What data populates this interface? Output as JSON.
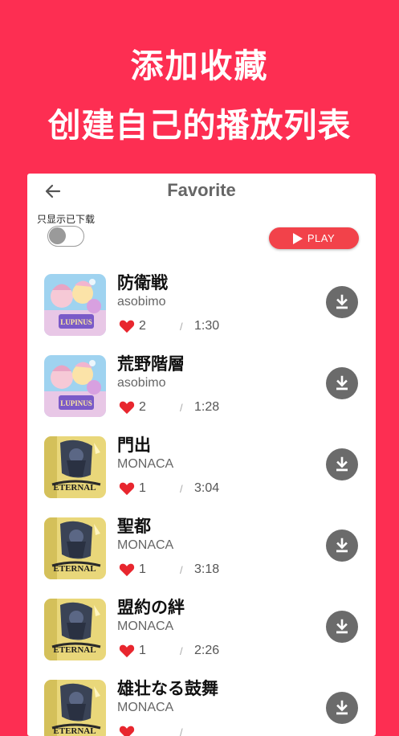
{
  "promo": {
    "line1": "添加收藏",
    "line2": "创建自己的播放列表"
  },
  "header": {
    "title": "Favorite",
    "back_icon": "arrow-left-icon"
  },
  "filter": {
    "label": "只显示已下载",
    "toggle_on": false
  },
  "play_button": {
    "label": "PLAY",
    "icon": "play-icon"
  },
  "colors": {
    "background": "#fd2e52",
    "play_button": "#f2424a",
    "heart": "#e8262e",
    "download_button": "#6b6b6b"
  },
  "songs": [
    {
      "title": "防衛戦",
      "artist": "asobimo",
      "likes": "2",
      "duration": "1:30",
      "art": "lupinus-cover"
    },
    {
      "title": "荒野階層",
      "artist": "asobimo",
      "likes": "2",
      "duration": "1:28",
      "art": "lupinus-cover"
    },
    {
      "title": "門出",
      "artist": "MONACA",
      "likes": "1",
      "duration": "3:04",
      "art": "eternal-cover"
    },
    {
      "title": "聖都",
      "artist": "MONACA",
      "likes": "1",
      "duration": "3:18",
      "art": "eternal-cover"
    },
    {
      "title": "盟約の絆",
      "artist": "MONACA",
      "likes": "1",
      "duration": "2:26",
      "art": "eternal-cover"
    },
    {
      "title": "雄壮なる鼓舞",
      "artist": "MONACA",
      "likes": "",
      "duration": "",
      "art": "eternal-cover"
    }
  ],
  "separator": "/"
}
